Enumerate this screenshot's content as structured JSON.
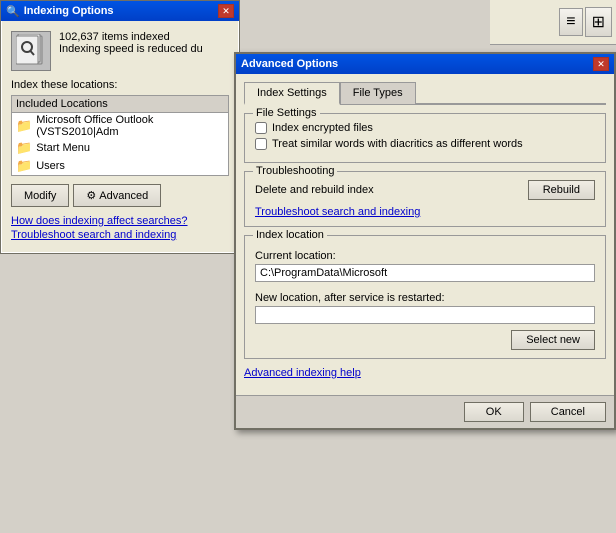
{
  "indexing_window": {
    "title": "Indexing Options",
    "items_indexed": "102,637 items indexed",
    "speed_notice": "Indexing speed is reduced du",
    "index_label": "Index these locations:",
    "included_locations_header": "Included Locations",
    "locations": [
      "Microsoft Office Outlook (VSTS2010|Adm",
      "Start Menu",
      "Users"
    ],
    "modify_btn": "Modify",
    "advanced_btn": "Advanced",
    "link1": "How does indexing affect searches?",
    "link2": "Troubleshoot search and indexing"
  },
  "advanced_dialog": {
    "title": "Advanced Options",
    "close_label": "✕",
    "tabs": [
      "Index Settings",
      "File Types"
    ],
    "active_tab": "Index Settings",
    "file_settings_group": "File Settings",
    "checkbox1": "Index encrypted files",
    "checkbox2": "Treat similar words with diacritics as different words",
    "troubleshooting_group": "Troubleshooting",
    "delete_rebuild_label": "Delete and rebuild index",
    "rebuild_btn": "Rebuild",
    "troubleshoot_link": "Troubleshoot search and indexing",
    "index_location_group": "Index location",
    "current_location_label": "Current location:",
    "current_location_value": "C:\\ProgramData\\Microsoft",
    "new_location_label": "New location, after service is restarted:",
    "new_location_value": "",
    "select_new_btn": "Select new",
    "advanced_help_link": "Advanced indexing help",
    "ok_btn": "OK",
    "cancel_btn": "Cancel"
  },
  "toolbar": {
    "btn1": "≡",
    "btn2": "⊞"
  }
}
